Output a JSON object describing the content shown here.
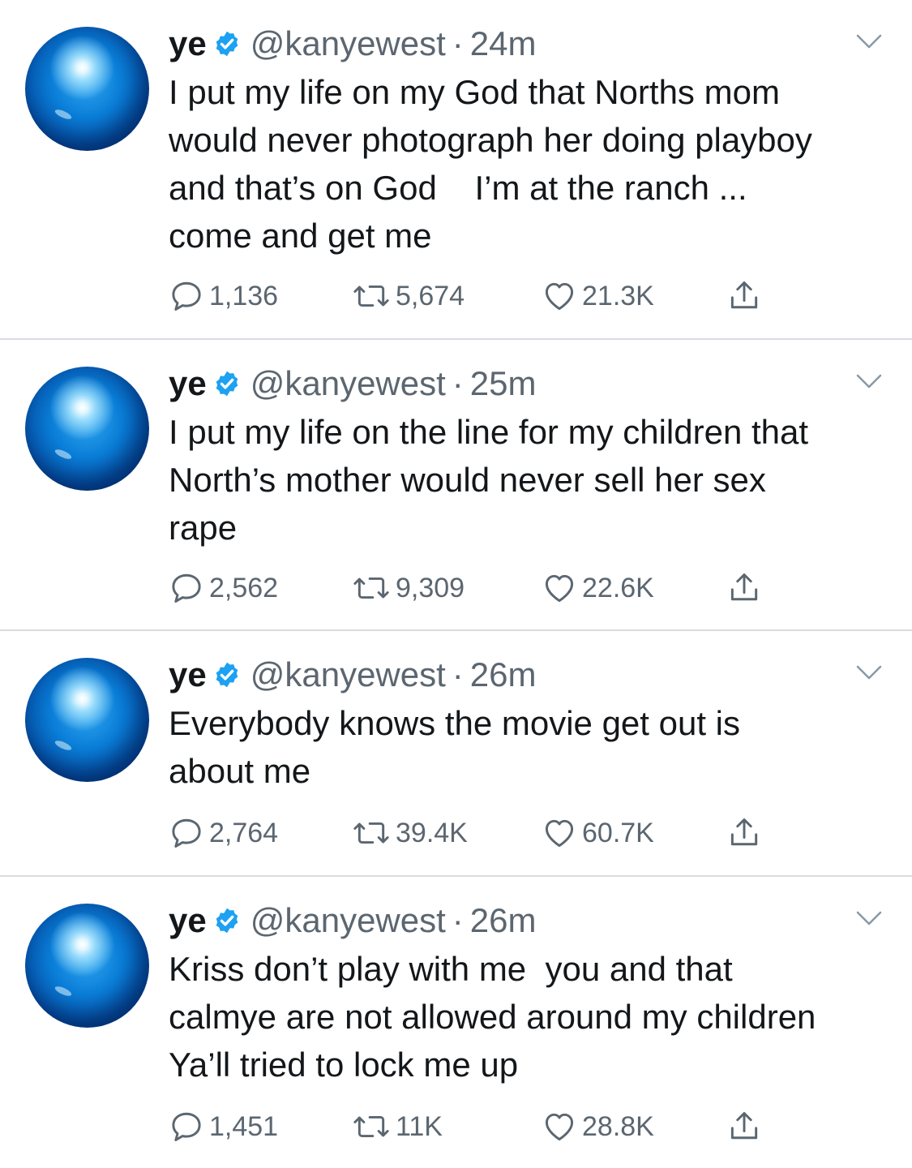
{
  "colors": {
    "text": "#14171a",
    "secondary": "#5b6670",
    "verified": "#1da1f2",
    "divider": "#d9dde1"
  },
  "tweets": [
    {
      "name": "ye",
      "handle": "@kanyewest",
      "dot": "·",
      "time": "24m",
      "lines": [
        "I put my life on my God that Norths mom",
        "would never photograph her doing playboy",
        "and that’s on God    I’m at the ranch ...",
        "come and get me"
      ],
      "replies": "1,136",
      "retweets": "5,674",
      "likes": "21.3K"
    },
    {
      "name": "ye",
      "handle": "@kanyewest",
      "dot": "·",
      "time": "25m",
      "lines": [
        "I put my life on the line for my children that",
        "North’s mother would never sell her sex",
        "rape"
      ],
      "replies": "2,562",
      "retweets": "9,309",
      "likes": "22.6K"
    },
    {
      "name": "ye",
      "handle": "@kanyewest",
      "dot": "·",
      "time": "26m",
      "lines": [
        "Everybody knows the movie get out is",
        "about me"
      ],
      "replies": "2,764",
      "retweets": "39.4K",
      "likes": "60.7K"
    },
    {
      "name": "ye",
      "handle": "@kanyewest",
      "dot": "·",
      "time": "26m",
      "lines": [
        "Kriss don’t play with me  you and that",
        "calmye are not allowed around my children",
        "Ya’ll tried to lock me up"
      ],
      "replies": "1,451",
      "retweets": "11K",
      "likes": "28.8K"
    }
  ]
}
